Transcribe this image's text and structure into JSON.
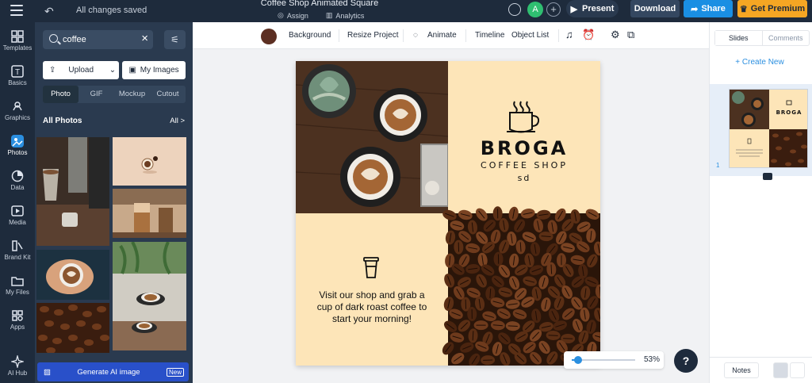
{
  "topbar": {
    "status": "All changes saved",
    "title": "Coffee Shop Animated Square",
    "assign_label": "Assign",
    "analytics_label": "Analytics",
    "avatar_initial": "A",
    "present_label": "Present",
    "download_label": "Download",
    "share_label": "Share",
    "premium_label": "Get Premium"
  },
  "rail": {
    "items": [
      {
        "label": "Templates",
        "icon": "templates-icon"
      },
      {
        "label": "Basics",
        "icon": "basics-icon"
      },
      {
        "label": "Graphics",
        "icon": "graphics-icon"
      },
      {
        "label": "Photos",
        "icon": "photos-icon"
      },
      {
        "label": "Data",
        "icon": "data-icon"
      },
      {
        "label": "Media",
        "icon": "media-icon"
      },
      {
        "label": "Brand Kit",
        "icon": "brand-kit-icon"
      },
      {
        "label": "My Files",
        "icon": "folder-icon"
      },
      {
        "label": "Apps",
        "icon": "apps-icon"
      },
      {
        "label": "AI Hub",
        "icon": "sparkle-icon"
      }
    ]
  },
  "panel": {
    "search_value": "coffee",
    "upload_label": "Upload",
    "my_images_label": "My Images",
    "tabs": [
      "Photo",
      "GIF",
      "Mockup",
      "Cutout"
    ],
    "section_title": "All Photos",
    "all_link": "All >",
    "generate_ai_label": "Generate AI image",
    "new_badge": "New"
  },
  "canvas_toolbar": {
    "color": "#5c2f22",
    "background_label": "Background",
    "resize_label": "Resize Project",
    "animate_label": "Animate",
    "timeline_label": "Timeline",
    "object_list_label": "Object List"
  },
  "design": {
    "brand": "BROGA",
    "subtitle": "COFFEE SHOP",
    "tagline": "sd",
    "cta_line1": "Visit our shop and grab a",
    "cta_line2": "cup of dark roast coffee to",
    "cta_line3": "start your morning!",
    "cream_color": "#fde5b8"
  },
  "zoom": {
    "value": "53%",
    "level": 0.1
  },
  "help_label": "?",
  "right_panel": {
    "tabs": [
      "Slides",
      "Comments"
    ],
    "create_new": "+ Create New",
    "slide_number": "1",
    "notes_label": "Notes"
  }
}
